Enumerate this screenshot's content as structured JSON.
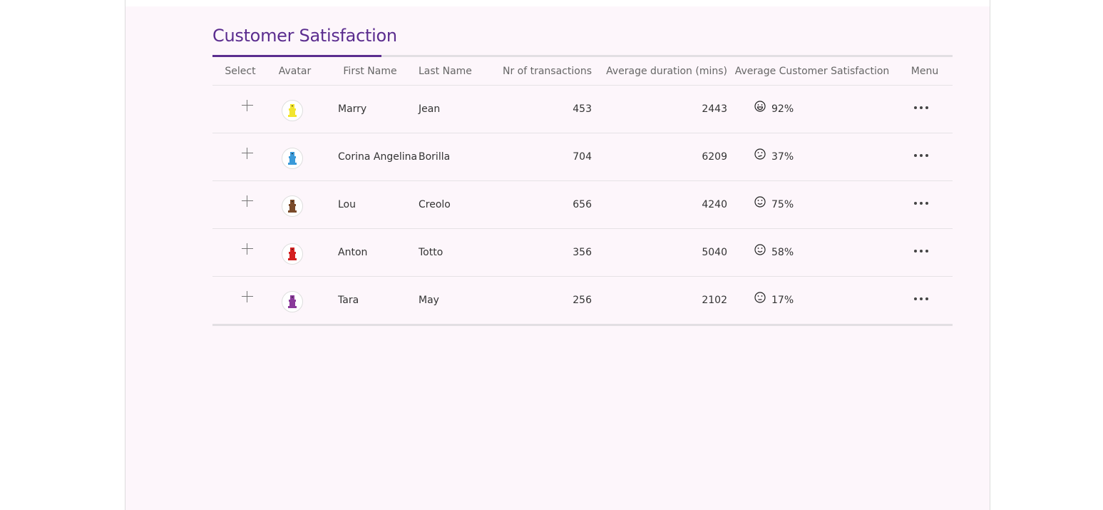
{
  "title": "Customer Satisfaction",
  "accent_color": "#5b2d8f",
  "columns": {
    "select": "Select",
    "avatar": "Avatar",
    "first_name": "First Name",
    "last_name": "Last Name",
    "transactions": "Nr of transactions",
    "duration": "Average duration (mins)",
    "satisfaction": "Average Customer Satisfaction",
    "menu": "Menu"
  },
  "rows": [
    {
      "first_name": "Marry",
      "last_name": "Jean",
      "transactions": "453",
      "duration": "2443",
      "satisfaction": "92%",
      "face_icon": "grinning-face-icon",
      "avatar_color": "#f2e52e"
    },
    {
      "first_name": "Corina Angelina",
      "last_name": "Borilla",
      "transactions": "704",
      "duration": "6209",
      "satisfaction": "37%",
      "face_icon": "confused-face-icon",
      "avatar_color": "#3a9ad9"
    },
    {
      "first_name": "Lou",
      "last_name": "Creolo",
      "transactions": "656",
      "duration": "4240",
      "satisfaction": "75%",
      "face_icon": "smiling-face-icon",
      "avatar_color": "#7a4a2a"
    },
    {
      "first_name": "Anton",
      "last_name": "Totto",
      "transactions": "356",
      "duration": "5040",
      "satisfaction": "58%",
      "face_icon": "smiling-face-icon",
      "avatar_color": "#d42020"
    },
    {
      "first_name": "Tara",
      "last_name": "May",
      "transactions": "256",
      "duration": "2102",
      "satisfaction": "17%",
      "face_icon": "neutral-face-icon",
      "avatar_color": "#8a3a9a"
    }
  ]
}
